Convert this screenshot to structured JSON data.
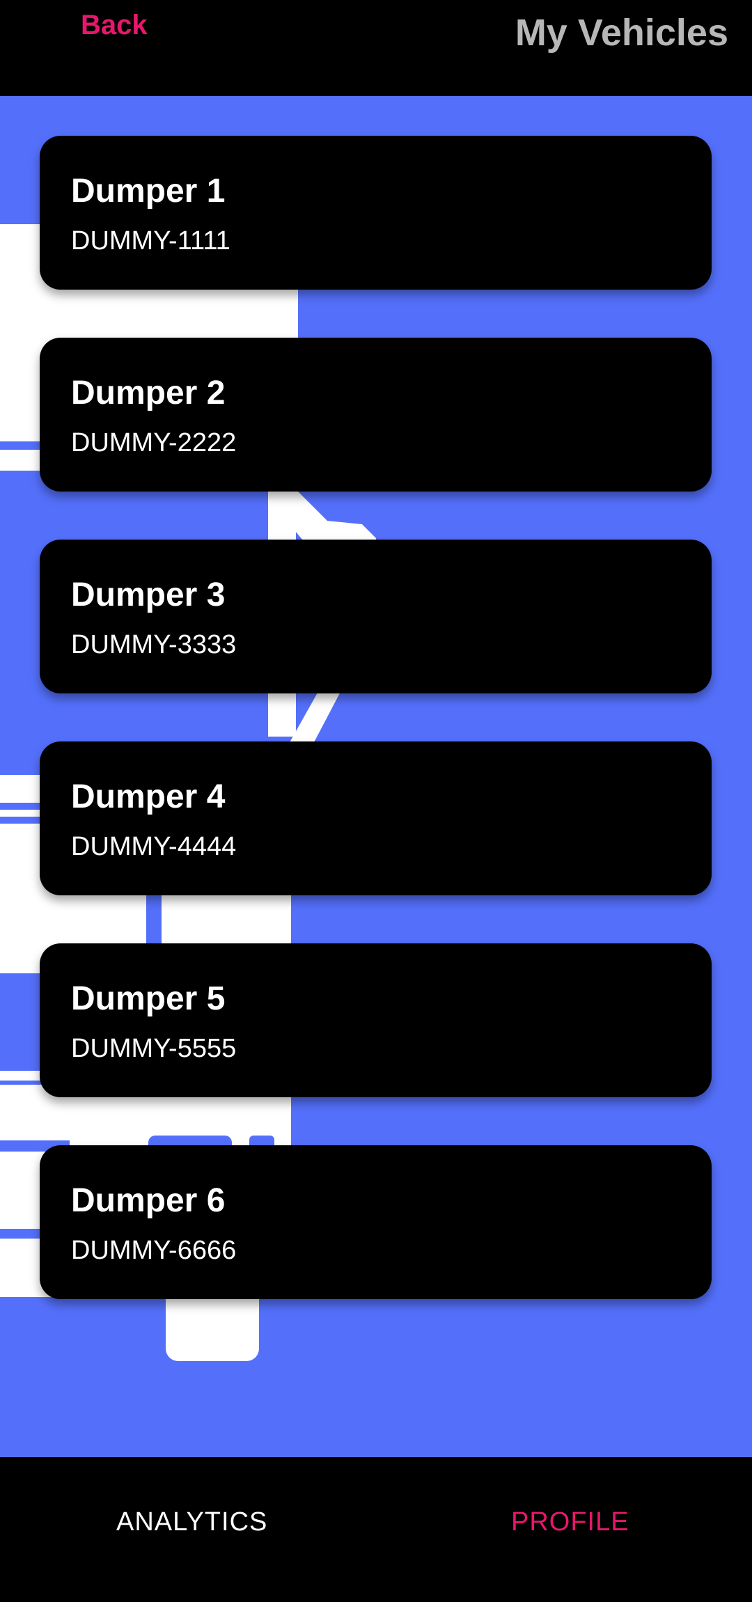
{
  "header": {
    "back_label": "Back",
    "title": "My Vehicles"
  },
  "vehicles": [
    {
      "name": "Dumper 1",
      "plate": "DUMMY-1111"
    },
    {
      "name": "Dumper 2",
      "plate": "DUMMY-2222"
    },
    {
      "name": "Dumper 3",
      "plate": "DUMMY-3333"
    },
    {
      "name": "Dumper 4",
      "plate": "DUMMY-4444"
    },
    {
      "name": "Dumper 5",
      "plate": "DUMMY-5555"
    },
    {
      "name": "Dumper 6",
      "plate": "DUMMY-6666"
    }
  ],
  "bottom_nav": {
    "analytics_label": "ANALYTICS",
    "profile_label": "PROFILE"
  },
  "colors": {
    "accent": "#e8176d",
    "background": "#5470fb",
    "card": "#000000",
    "title_gray": "#b7b7b7"
  },
  "icons": {
    "background_art": "dumper-truck-illustration"
  }
}
